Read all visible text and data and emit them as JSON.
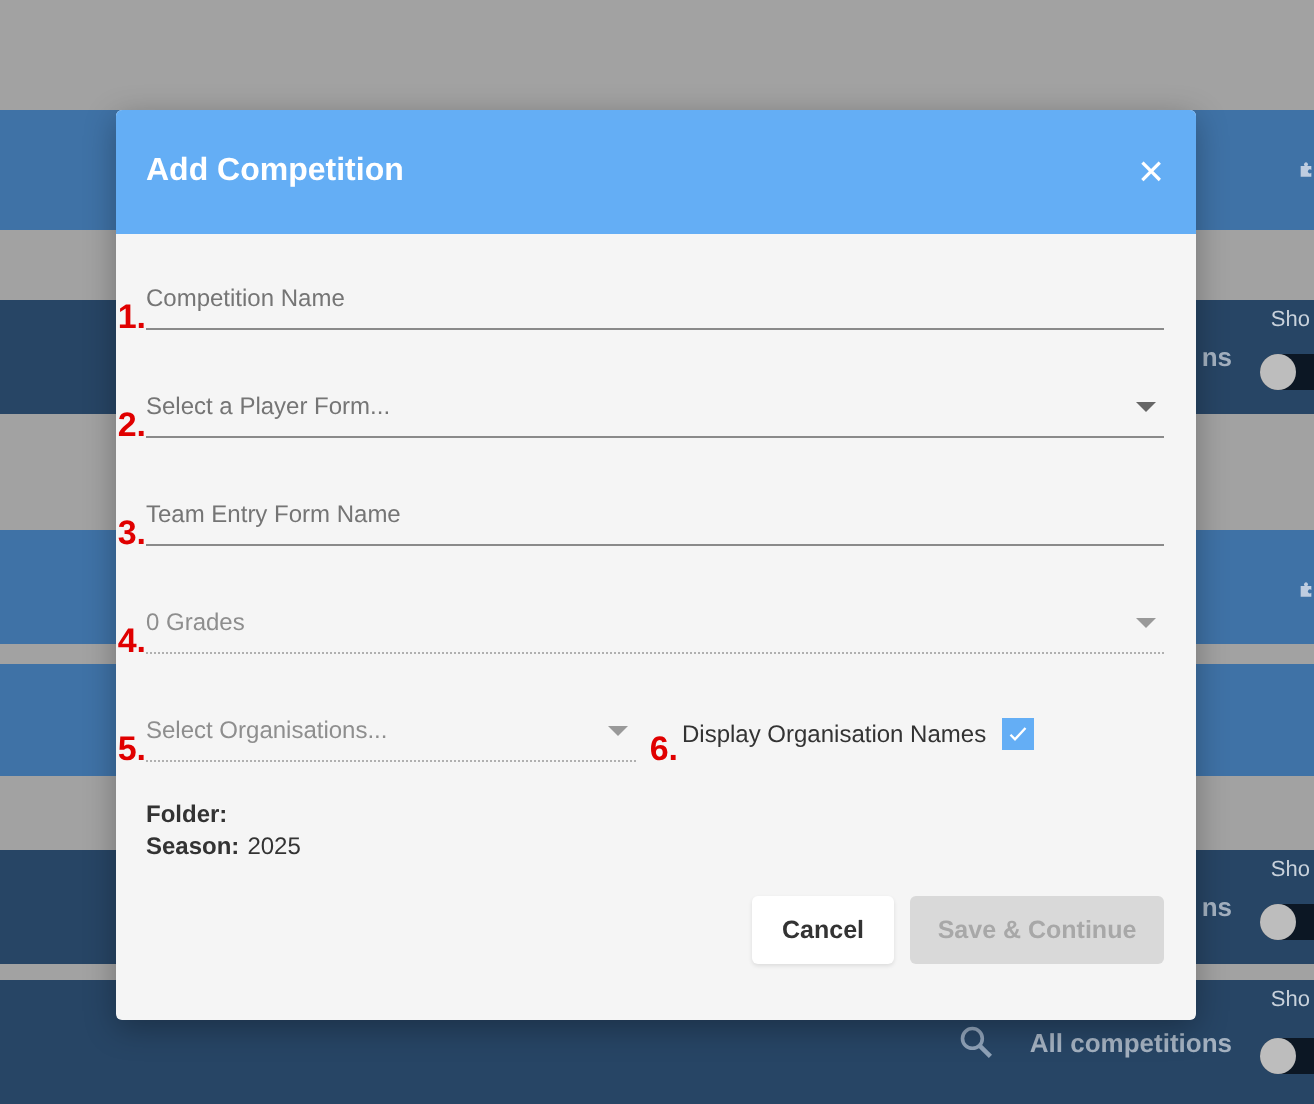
{
  "background_bars": [
    {
      "kind": "puzzle",
      "dark": false
    },
    {
      "kind": "switch",
      "dark": true,
      "label": "ns",
      "switch_label": "Sho",
      "switch_on": false
    },
    {
      "kind": "puzzle",
      "dark": false
    },
    {
      "kind": "plain",
      "dark": false
    },
    {
      "kind": "switch",
      "dark": true,
      "label": "ns",
      "switch_label": "Sho",
      "switch_on": false
    },
    {
      "kind": "search_switch",
      "dark": true,
      "label": "All competitions",
      "switch_label": "Sho",
      "switch_on": false
    }
  ],
  "dialog": {
    "title": "Add Competition",
    "close": "×",
    "fields": [
      {
        "kind": "text",
        "marker": "1.",
        "placeholder": "Competition Name",
        "disabled": false
      },
      {
        "kind": "select",
        "marker": "2.",
        "placeholder": "Select a Player Form...",
        "disabled": false
      },
      {
        "kind": "text",
        "marker": "3.",
        "placeholder": "Team Entry Form Name",
        "disabled": false
      },
      {
        "kind": "select",
        "marker": "4.",
        "placeholder": "0 Grades",
        "disabled": true
      }
    ],
    "organisations": {
      "marker": "5.",
      "placeholder": "Select Organisations...",
      "disabled": true
    },
    "display_names": {
      "marker": "6.",
      "label": "Display Organisation Names",
      "checked": true
    },
    "info": [
      {
        "label": "Folder:"
      },
      {
        "label": "Season:",
        "value": "2025"
      }
    ],
    "buttons": [
      {
        "label": "Cancel",
        "disabled": false
      },
      {
        "label": "Save & Continue",
        "disabled": true
      }
    ]
  }
}
